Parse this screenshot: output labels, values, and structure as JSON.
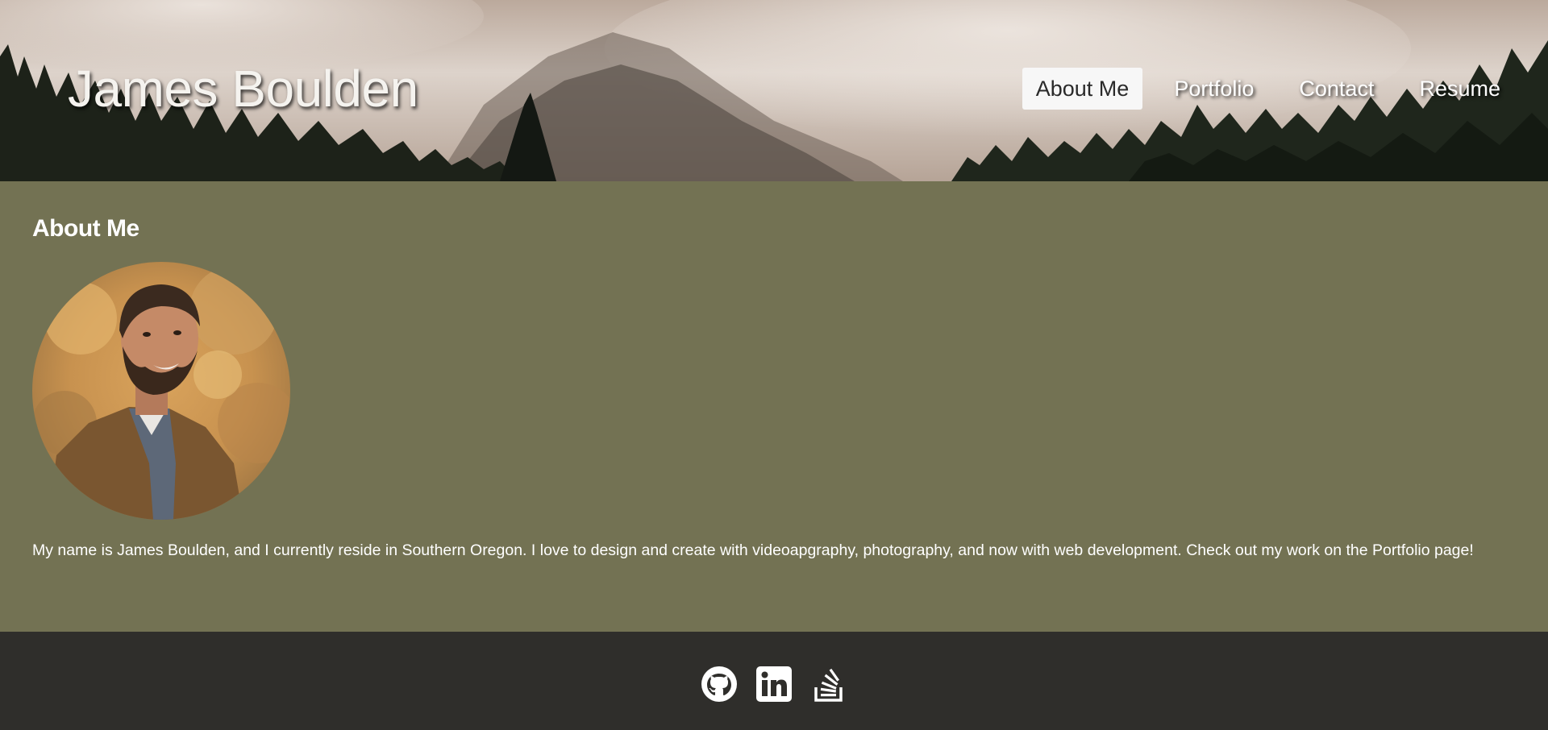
{
  "header": {
    "site_title": "James Boulden",
    "nav": [
      {
        "label": "About Me",
        "active": true
      },
      {
        "label": "Portfolio",
        "active": false
      },
      {
        "label": "Contact",
        "active": false
      },
      {
        "label": "Resume",
        "active": false
      }
    ]
  },
  "main": {
    "heading": "About Me",
    "avatar_alt": "Photo of James Boulden",
    "bio": "My name is James Boulden, and I currently reside in Southern Oregon. I love to design and create with videoapgraphy, photography, and now with web development. Check out my work on the Portfolio page!"
  },
  "footer": {
    "social": [
      {
        "name": "github-icon"
      },
      {
        "name": "linkedin-icon"
      },
      {
        "name": "stackoverflow-icon"
      }
    ]
  },
  "colors": {
    "main_bg": "#737253",
    "footer_bg": "#2f2e2b",
    "nav_active_bg": "#f7f7f7",
    "text": "#ffffff"
  }
}
